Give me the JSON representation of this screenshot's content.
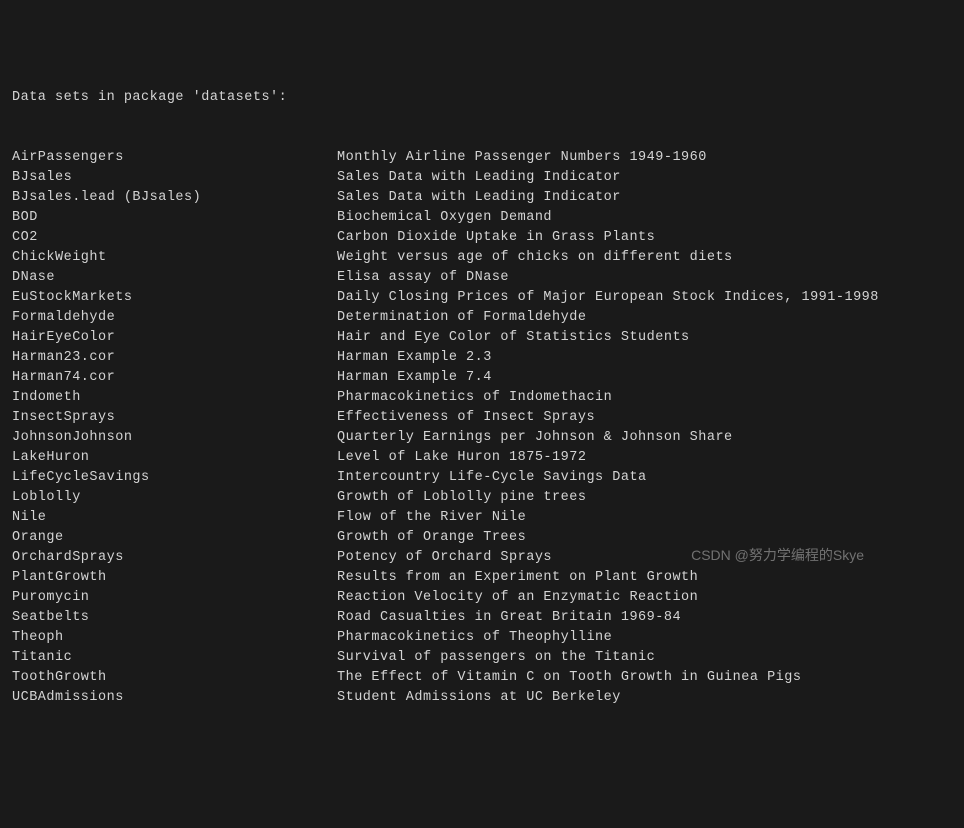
{
  "header": "Data sets in package 'datasets':",
  "datasets": [
    {
      "name": "AirPassengers",
      "desc": "Monthly Airline Passenger Numbers 1949-1960"
    },
    {
      "name": "BJsales",
      "desc": "Sales Data with Leading Indicator"
    },
    {
      "name": "BJsales.lead (BJsales)",
      "desc": "Sales Data with Leading Indicator"
    },
    {
      "name": "BOD",
      "desc": "Biochemical Oxygen Demand"
    },
    {
      "name": "CO2",
      "desc": "Carbon Dioxide Uptake in Grass Plants"
    },
    {
      "name": "ChickWeight",
      "desc": "Weight versus age of chicks on different diets"
    },
    {
      "name": "DNase",
      "desc": "Elisa assay of DNase"
    },
    {
      "name": "EuStockMarkets",
      "desc": "Daily Closing Prices of Major European Stock Indices, 1991-1998"
    },
    {
      "name": "Formaldehyde",
      "desc": "Determination of Formaldehyde"
    },
    {
      "name": "HairEyeColor",
      "desc": "Hair and Eye Color of Statistics Students"
    },
    {
      "name": "Harman23.cor",
      "desc": "Harman Example 2.3"
    },
    {
      "name": "Harman74.cor",
      "desc": "Harman Example 7.4"
    },
    {
      "name": "Indometh",
      "desc": "Pharmacokinetics of Indomethacin"
    },
    {
      "name": "InsectSprays",
      "desc": "Effectiveness of Insect Sprays"
    },
    {
      "name": "JohnsonJohnson",
      "desc": "Quarterly Earnings per Johnson & Johnson Share"
    },
    {
      "name": "LakeHuron",
      "desc": "Level of Lake Huron 1875-1972"
    },
    {
      "name": "LifeCycleSavings",
      "desc": "Intercountry Life-Cycle Savings Data"
    },
    {
      "name": "Loblolly",
      "desc": "Growth of Loblolly pine trees"
    },
    {
      "name": "Nile",
      "desc": "Flow of the River Nile"
    },
    {
      "name": "Orange",
      "desc": "Growth of Orange Trees"
    },
    {
      "name": "OrchardSprays",
      "desc": "Potency of Orchard Sprays"
    },
    {
      "name": "PlantGrowth",
      "desc": "Results from an Experiment on Plant Growth"
    },
    {
      "name": "Puromycin",
      "desc": "Reaction Velocity of an Enzymatic Reaction"
    },
    {
      "name": "Seatbelts",
      "desc": "Road Casualties in Great Britain 1969-84"
    },
    {
      "name": "Theoph",
      "desc": "Pharmacokinetics of Theophylline"
    },
    {
      "name": "Titanic",
      "desc": "Survival of passengers on the Titanic"
    },
    {
      "name": "ToothGrowth",
      "desc": "The Effect of Vitamin C on Tooth Growth in Guinea Pigs"
    },
    {
      "name": "UCBAdmissions",
      "desc": "Student Admissions at UC Berkeley"
    }
  ],
  "watermark": "CSDN @努力学编程的Skye"
}
